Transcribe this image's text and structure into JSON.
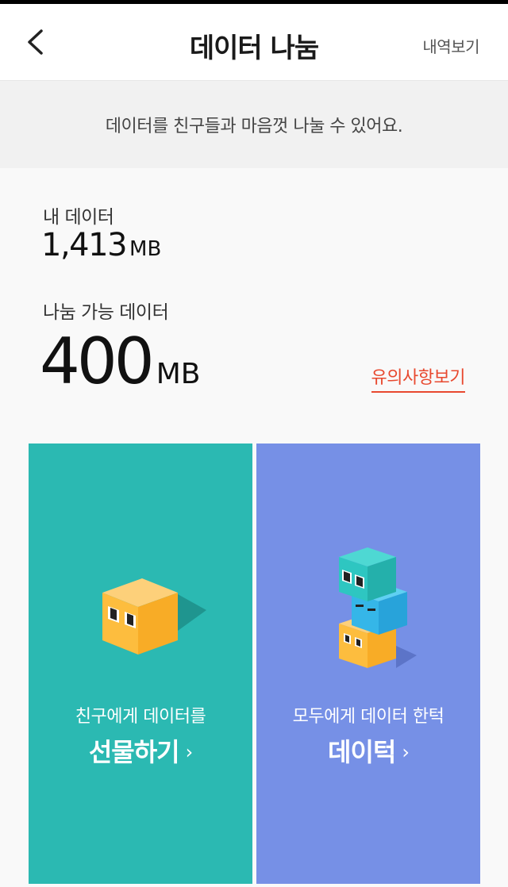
{
  "header": {
    "back_icon": "chevron-left-icon",
    "title": "데이터 나눔",
    "history_label": "내역보기"
  },
  "banner": {
    "text": "데이터를 친구들과 마음껏 나눌 수 있어요."
  },
  "my_data": {
    "label": "내 데이터",
    "value": "1,413",
    "unit": "MB"
  },
  "shareable_data": {
    "label": "나눔 가능 데이터",
    "value": "400",
    "unit": "MB"
  },
  "notice_link": "유의사항보기",
  "cards": {
    "gift": {
      "subtitle": "친구에게 데이터를",
      "title": "선물하기",
      "chevron": "›",
      "color": "#2bb9b2"
    },
    "treat": {
      "subtitle": "모두에게 데이터 한턱",
      "title": "데이턱",
      "chevron": "›",
      "color": "#7690e6"
    }
  },
  "colors": {
    "accent_link": "#e8492f",
    "header_bg": "#ffffff",
    "banner_bg": "#f1f1f1"
  }
}
